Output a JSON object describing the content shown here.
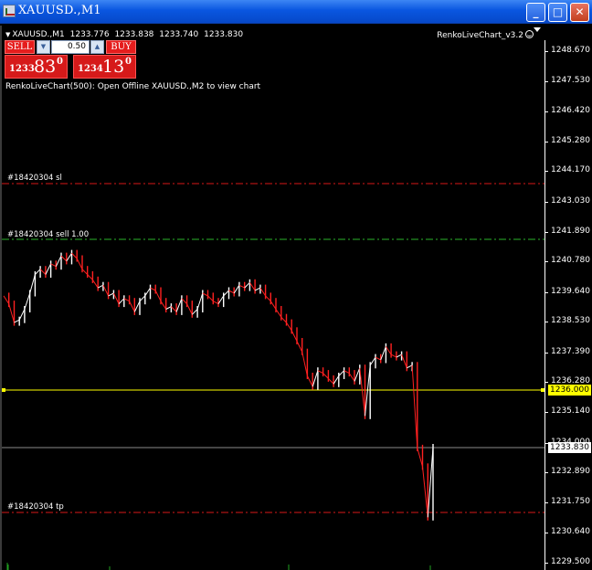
{
  "window": {
    "title": "XAUUSD.,M1",
    "min_label": "_",
    "max_label": "□",
    "close_label": "✕"
  },
  "chart_header": {
    "symbol": "XAUUSD.,M1",
    "open": "1233.776",
    "high": "1233.838",
    "low": "1233.740",
    "close": "1233.830"
  },
  "expert": {
    "name": "RenkoLiveChart_v3.2"
  },
  "one_click": {
    "sell_label": "SELL",
    "buy_label": "BUY",
    "lot_value": "0.50",
    "sell_price_big": "1233",
    "sell_price_pips": "83",
    "sell_price_point": "0",
    "buy_price_big": "1234",
    "buy_price_pips": "13",
    "buy_price_point": "0"
  },
  "info_message": "RenkoLiveChart(500): Open Offline XAUUSD.,M2 to view chart",
  "order_lines": {
    "sl_label": "#18420304 sl",
    "sell_label": "#18420304 sell 1.00",
    "tp_label": "#18420304 tp"
  },
  "price_axis": {
    "ticks": [
      "1248.670",
      "1247.530",
      "1246.420",
      "1245.280",
      "1244.170",
      "1243.030",
      "1241.890",
      "1240.780",
      "1239.640",
      "1238.530",
      "1237.390",
      "1236.280",
      "1235.140",
      "1234.000",
      "1232.890",
      "1231.750",
      "1230.640",
      "1229.500"
    ],
    "alert_price": "1236.000",
    "bid_price": "1233.830"
  },
  "colors": {
    "sl_line": "#d81818",
    "entry_line": "#2bb52b",
    "tp_line": "#d81818",
    "alert_line": "#ffff00",
    "bid_line": "#8a8a8a",
    "bull_bar": "#ffffff",
    "bear_bar": "#ff2020",
    "volume": "#1fa01f"
  },
  "chart_data": {
    "type": "line",
    "title": "",
    "xlabel": "",
    "ylabel": "",
    "ylim": [
      1229.5,
      1249.2
    ],
    "series": [
      {
        "values": [
          1239.5,
          1239.2,
          1238.5,
          1238.6,
          1239.0,
          1239.6,
          1240.3,
          1240.5,
          1240.3,
          1240.7,
          1240.6,
          1241.0,
          1240.8,
          1241.1,
          1240.9,
          1240.5,
          1240.3,
          1240.1,
          1239.8,
          1239.9,
          1239.5,
          1239.6,
          1239.2,
          1239.4,
          1239.3,
          1238.9,
          1239.3,
          1239.5,
          1239.8,
          1239.7,
          1239.3,
          1239.0,
          1239.1,
          1238.9,
          1239.4,
          1239.2,
          1238.8,
          1239.0,
          1239.6,
          1239.5,
          1239.3,
          1239.2,
          1239.5,
          1239.7,
          1239.6,
          1239.9,
          1239.8,
          1240.0,
          1239.7,
          1239.8,
          1239.5,
          1239.3,
          1239.0,
          1238.7,
          1238.5,
          1238.2,
          1237.8,
          1237.4,
          1236.5,
          1236.1,
          1236.7,
          1236.6,
          1236.4,
          1236.2,
          1236.5,
          1236.7,
          1236.6,
          1236.3,
          1236.8,
          1235.0,
          1236.9,
          1237.2,
          1237.1,
          1237.6,
          1237.3,
          1237.2,
          1237.3,
          1236.8,
          1236.9,
          1233.8,
          1233.1,
          1231.2,
          1233.83
        ]
      }
    ]
  }
}
